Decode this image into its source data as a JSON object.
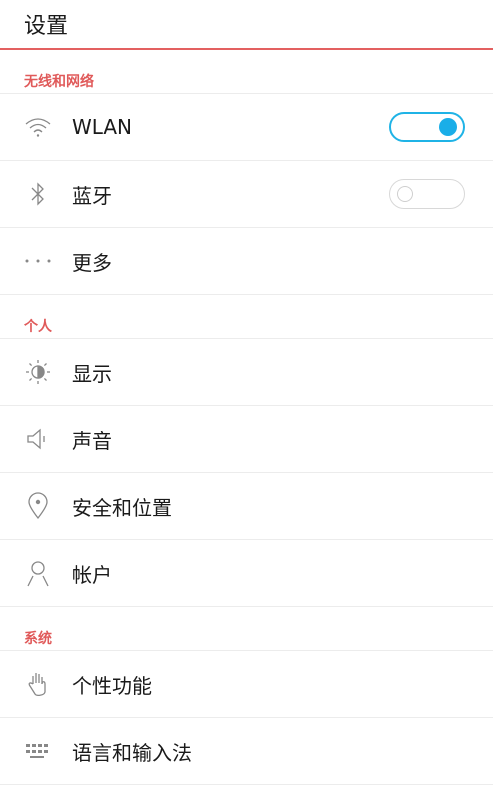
{
  "header": {
    "title": "设置"
  },
  "sections": [
    {
      "title": "无线和网络",
      "items": [
        {
          "label": "WLAN",
          "icon": "wifi-icon",
          "toggle": "on"
        },
        {
          "label": "蓝牙",
          "icon": "bluetooth-icon",
          "toggle": "off"
        },
        {
          "label": "更多",
          "icon": "more-dots-icon"
        }
      ]
    },
    {
      "title": "个人",
      "items": [
        {
          "label": "显示",
          "icon": "brightness-icon"
        },
        {
          "label": "声音",
          "icon": "speaker-icon"
        },
        {
          "label": "安全和位置",
          "icon": "location-pin-icon"
        },
        {
          "label": "帐户",
          "icon": "account-icon"
        }
      ]
    },
    {
      "title": "系统",
      "items": [
        {
          "label": "个性功能",
          "icon": "hand-gesture-icon"
        },
        {
          "label": "语言和输入法",
          "icon": "keyboard-icon"
        }
      ]
    }
  ],
  "colors": {
    "accent": "#e05a5a",
    "toggle_on": "#1aaee8"
  }
}
